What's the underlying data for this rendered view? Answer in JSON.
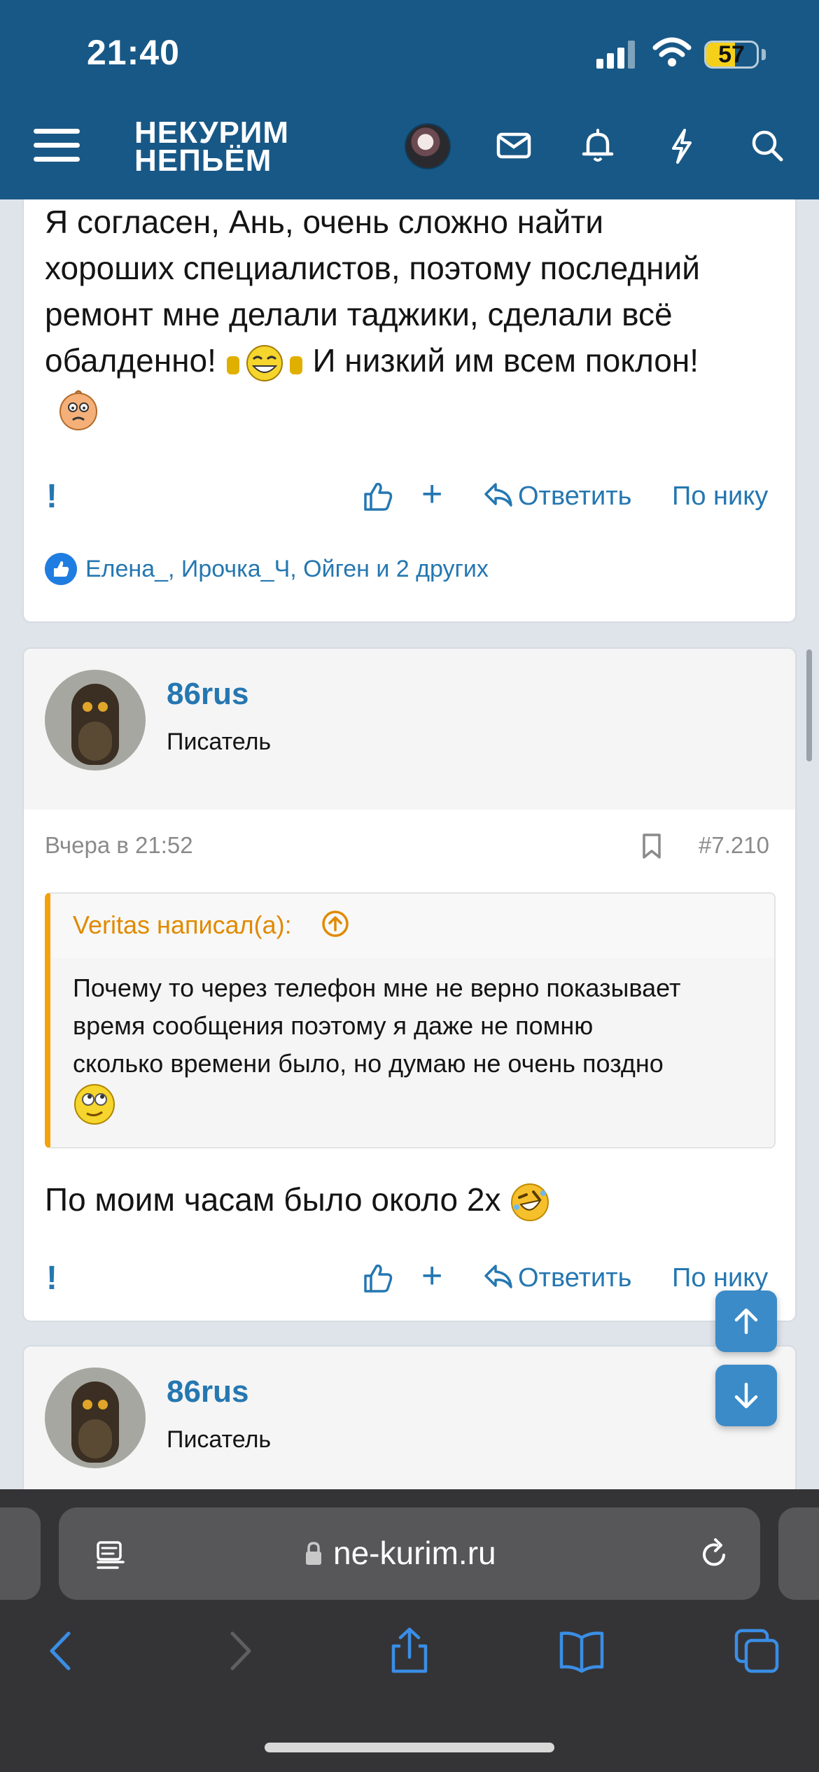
{
  "status_bar": {
    "time": "21:40",
    "battery": "57",
    "battery_level": 0.57
  },
  "header": {
    "logo_line1": "НЕКУРИМ",
    "logo_line2": "НЕПЬЁМ",
    "icons": [
      "menu-icon",
      "avatar",
      "envelope-icon",
      "bell-icon",
      "bolt-icon",
      "search-icon"
    ],
    "colors": {
      "header_bg": "#185886",
      "link": "#2577b1",
      "quote_accent": "#f4a10c"
    }
  },
  "posts": [
    {
      "body_lines": [
        "Я согласен, Ань, очень сложно найти",
        "хороших специалистов, поэтому последний",
        "ремонт мне делали таджики, сделали всё",
        "обалденно!",
        "И низкий им всем поклон!"
      ],
      "actions": {
        "report": "!",
        "plus": "+",
        "reply": "Ответить",
        "nick": "По нику"
      },
      "reactions": "Елена_, Ирочка_Ч, Ойген и 2 других"
    },
    {
      "username": "86rus",
      "user_title": "Писатель",
      "date": "Вчера в 21:52",
      "number": "#7.210",
      "quote": {
        "author": "Veritas написал(а):",
        "text_lines": [
          "Почему то через телефон мне не верно показывает",
          "время сообщения поэтому я даже не помню",
          "сколько времени было, но думаю не очень поздно"
        ]
      },
      "body": "По моим часам было около 2х",
      "actions": {
        "report": "!",
        "plus": "+",
        "reply": "Ответить",
        "nick": "По нику"
      }
    },
    {
      "username": "86rus",
      "user_title": "Писатель"
    }
  ],
  "browser": {
    "url": "ne-kurim.ru"
  }
}
